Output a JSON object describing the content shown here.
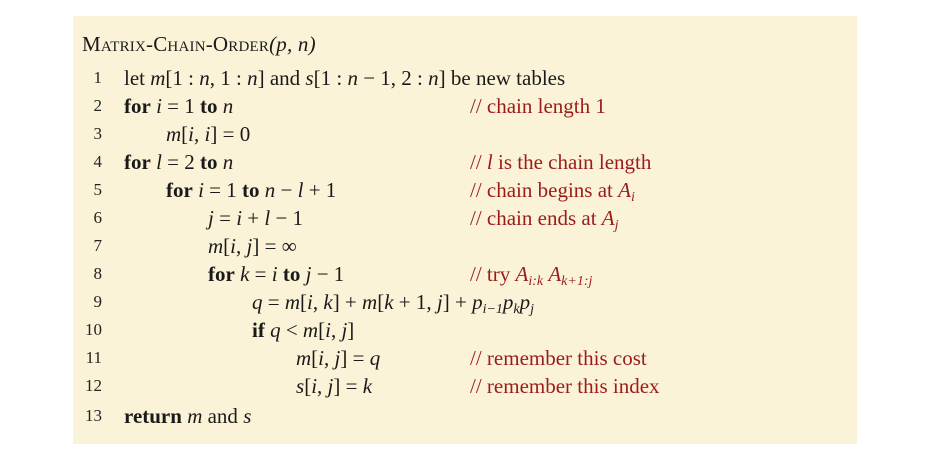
{
  "procedure": {
    "name_part1": "M",
    "name_part2": "atrix",
    "name_part3": "-C",
    "name_part4": "hain",
    "name_part5": "-O",
    "name_part6": "rder",
    "params": "(p, n)"
  },
  "lines": [
    {
      "num": "1",
      "code": "let m[1 : n, 1 : n] and s[1 : n − 1, 2 : n] be new tables",
      "comment": ""
    },
    {
      "num": "2",
      "code": "for i = 1 to n",
      "comment": "// chain length 1"
    },
    {
      "num": "3",
      "code": "m[i, i] = 0",
      "comment": ""
    },
    {
      "num": "4",
      "code": "for l = 2 to n",
      "comment": "// l is the chain length"
    },
    {
      "num": "5",
      "code": "for i = 1 to n − l + 1",
      "comment": "// chain begins at A_i"
    },
    {
      "num": "6",
      "code": "j = i + l − 1",
      "comment": "// chain ends at A_j"
    },
    {
      "num": "7",
      "code": "m[i, j] = ∞",
      "comment": ""
    },
    {
      "num": "8",
      "code": "for k = i to j − 1",
      "comment": "// try A_{i:k} A_{k+1:j}"
    },
    {
      "num": "9",
      "code": "q = m[i, k] + m[k + 1, j] + p_{i−1} p_k p_j",
      "comment": ""
    },
    {
      "num": "10",
      "code": "if q < m[i, j]",
      "comment": ""
    },
    {
      "num": "11",
      "code": "m[i, j] = q",
      "comment": "// remember this cost"
    },
    {
      "num": "12",
      "code": "s[i, j] = k",
      "comment": "// remember this index"
    },
    {
      "num": "13",
      "code": "return m and s",
      "comment": ""
    }
  ],
  "colors": {
    "panel_background": "#fbf3d7",
    "comment_text": "#9b1b1b",
    "code_text": "#1a1a1a"
  }
}
